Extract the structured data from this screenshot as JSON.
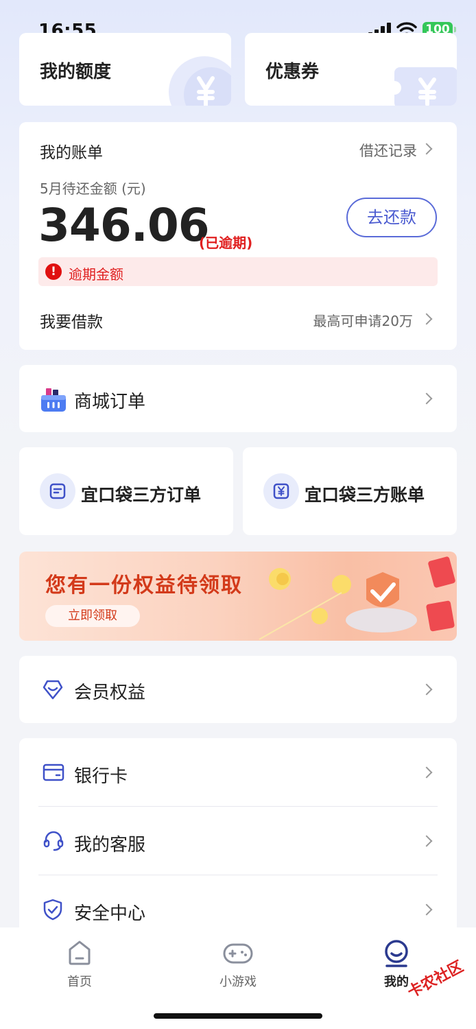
{
  "status_bar": {
    "time": "16:55",
    "battery": "100"
  },
  "top_cards": {
    "quota": "我的额度",
    "coupon": "优惠券"
  },
  "bill": {
    "title": "我的账单",
    "history_link": "借还记录",
    "month_label": "5月待还金额 (元)",
    "amount": "346.06",
    "overdue_tag": "(已逾期)",
    "repay_button": "去还款",
    "overdue_notice": "逾期金额",
    "borrow_label": "我要借款",
    "borrow_limit": "最高可申请20万"
  },
  "mall_order": {
    "label": "商城订单"
  },
  "third_party": {
    "orders": "宜口袋三方订单",
    "bills": "宜口袋三方账单"
  },
  "banner": {
    "title": "您有一份权益待领取",
    "button": "立即领取"
  },
  "member": {
    "label": "会员权益"
  },
  "menu": {
    "bank_card": "银行卡",
    "customer_service": "我的客服",
    "security_center": "安全中心"
  },
  "tabbar": {
    "tabs": [
      {
        "label": "首页",
        "icon": "home-icon"
      },
      {
        "label": "小游戏",
        "icon": "gamepad-icon"
      },
      {
        "label": "我的",
        "icon": "profile-icon",
        "active": true
      }
    ]
  },
  "watermark": "卡农社区",
  "colors": {
    "accent": "#4b5bd0",
    "danger": "#e02020",
    "battery": "#34c759"
  }
}
